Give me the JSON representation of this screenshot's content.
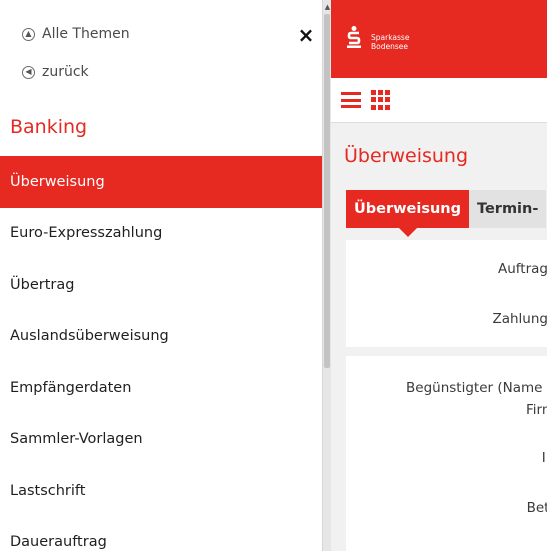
{
  "sidebar": {
    "all_topics": "Alle Themen",
    "back": "zurück",
    "close": "×",
    "section_heading": "Banking",
    "items": [
      {
        "label": "Überweisung",
        "active": true
      },
      {
        "label": "Euro-Expresszahlung",
        "active": false
      },
      {
        "label": "Übertrag",
        "active": false
      },
      {
        "label": "Auslandsüberweisung",
        "active": false
      },
      {
        "label": "Empfängerdaten",
        "active": false
      },
      {
        "label": "Sammler-Vorlagen",
        "active": false
      },
      {
        "label": "Lastschrift",
        "active": false
      },
      {
        "label": "Dauerauftrag",
        "active": false
      }
    ]
  },
  "header": {
    "brand_line1": "Sparkasse",
    "brand_line2": "Bodensee"
  },
  "page": {
    "title": "Überweisung",
    "tabs": [
      "Überweisung",
      "Termin-"
    ],
    "panel1_fields": [
      "Auftrags",
      "Zahlungs"
    ],
    "panel2_fields": [
      "Begünstigter (Name o",
      "Firm",
      "IB",
      "Betr"
    ]
  },
  "colors": {
    "accent": "#e62921",
    "background": "#f1f1f1"
  },
  "icons": [
    "chevron-up-circle-icon",
    "chevron-left-circle-icon",
    "close-icon",
    "hamburger-icon",
    "grid-icon",
    "sparkasse-logo-icon"
  ]
}
